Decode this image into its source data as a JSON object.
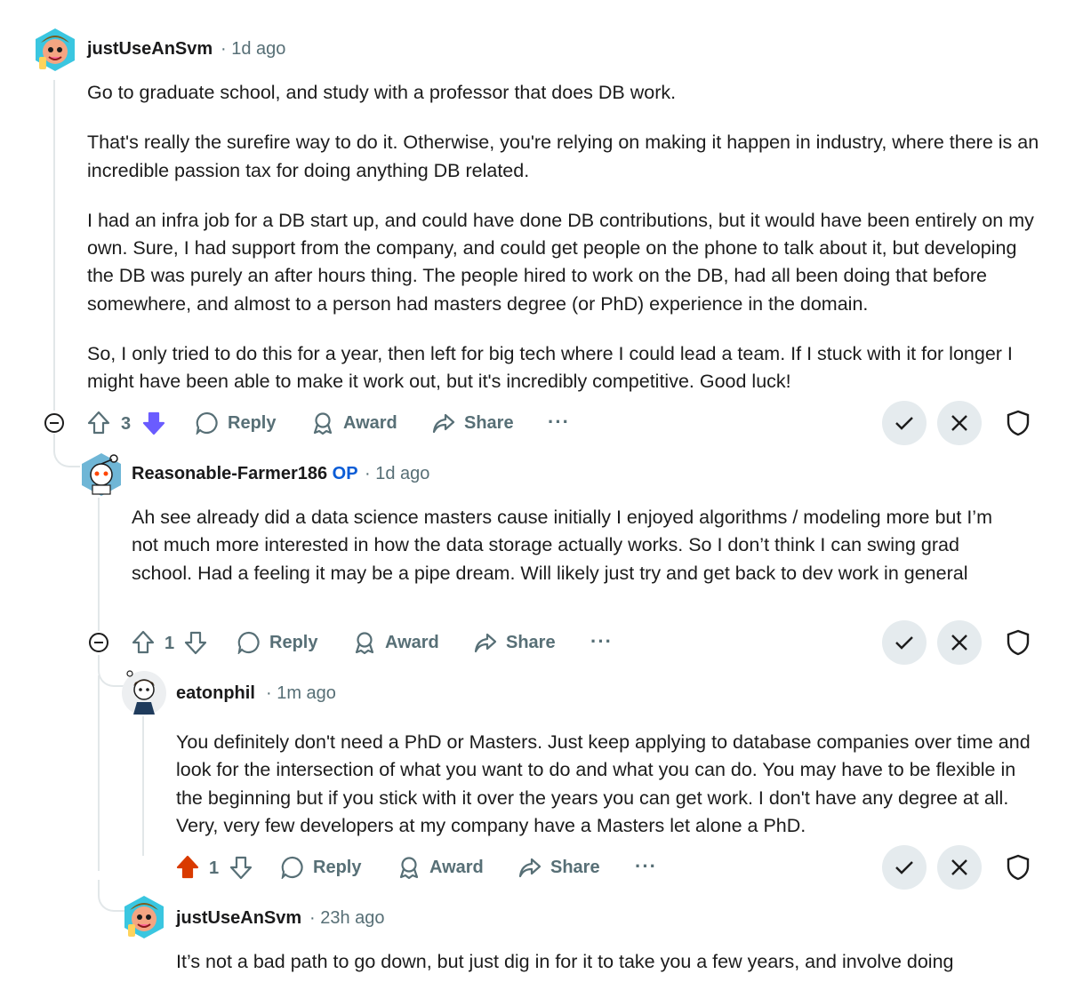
{
  "comments": [
    {
      "author": "justUseAnSvm",
      "time": "1d ago",
      "paragraphs": [
        "Go to graduate school, and study with a professor that does DB work.",
        "That's really the surefire way to do it. Otherwise, you're relying on making it happen in industry, where there is an incredible passion tax for doing anything DB related.",
        "I had an infra job for a DB start up, and could have done DB contributions, but it would have been entirely on my own. Sure, I had support from the company, and could get people on the phone to talk about it, but developing the DB was purely an after hours thing. The people hired to work on the DB, had all been doing that before somewhere, and almost to a person had masters degree (or PhD) experience in the domain.",
        "So, I only tried to do this for a year, then left for big tech where I could lead a team. If I stuck with it for longer I might have been able to make it work out, but it's incredibly competitive. Good luck!"
      ],
      "votes": "3",
      "vote_state": "downvoted"
    },
    {
      "author": "Reasonable-Farmer186",
      "op_badge": "OP",
      "time": "1d ago",
      "paragraphs": [
        "Ah see already did a data science masters cause initially I enjoyed algorithms / modeling more but I’m not much more interested in how the data storage actually works. So I don’t think I can swing grad school. Had a feeling it may be a pipe dream. Will likely just try and get back to dev work in general"
      ],
      "votes": "1",
      "vote_state": "none"
    },
    {
      "author": "eatonphil",
      "time": "1m ago",
      "paragraphs": [
        "You definitely don't need a PhD or Masters. Just keep applying to database companies over time and look for the intersection of what you want to do and what you can do. You may have to be flexible in the beginning but if you stick with it over the years you can get work. I don't have any degree at all. Very, very few developers at my company have a Masters let alone a PhD."
      ],
      "votes": "1",
      "vote_state": "upvoted"
    },
    {
      "author": "justUseAnSvm",
      "time": "23h ago",
      "paragraphs": [
        "It’s not a bad path to go down, but just dig in for it to take you a few years, and involve doing"
      ]
    }
  ],
  "actions": {
    "reply": "Reply",
    "award": "Award",
    "share": "Share",
    "more": "···"
  },
  "colors": {
    "upvote_active": "#d93a00",
    "downvote_active": "#6a5cff",
    "op_badge": "#0a5cd6",
    "meta_text": "#576f76",
    "thread_line": "#e2e7e9",
    "mod_button_bg": "#e5ebee"
  },
  "icons": [
    "upvote-icon",
    "downvote-icon",
    "comment-icon",
    "award-icon",
    "share-icon",
    "approve-icon",
    "remove-icon",
    "shield-icon",
    "collapse-icon"
  ]
}
